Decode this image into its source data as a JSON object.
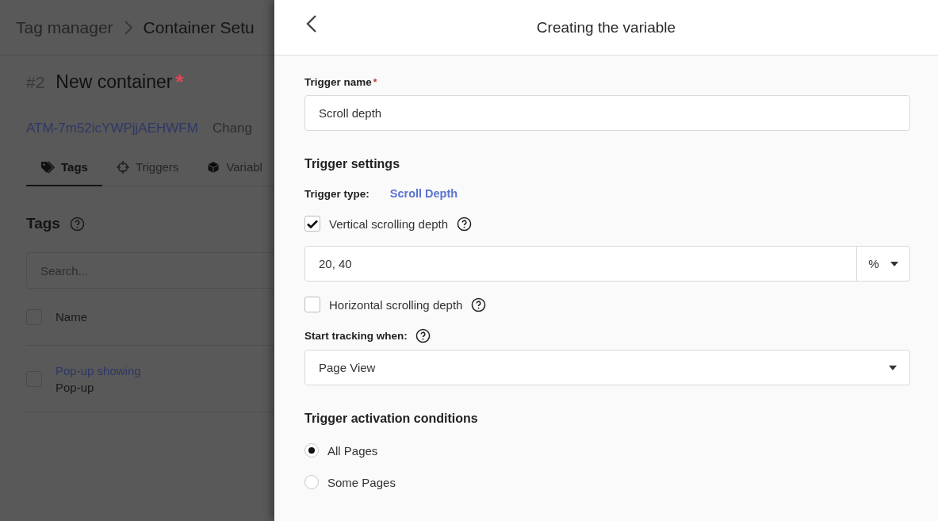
{
  "background": {
    "breadcrumb": [
      "Tag manager",
      "Container Setu"
    ],
    "container": {
      "number": "#2",
      "name": "New container",
      "required_mark": "*"
    },
    "container_id": "ATM-7m52icYWPjjAEHWFM",
    "change_link": "Chang",
    "tabs": [
      {
        "label": "Tags",
        "selected": true
      },
      {
        "label": "Triggers",
        "selected": false
      },
      {
        "label": "Variabl",
        "selected": false
      }
    ],
    "section_title": "Tags",
    "search": {
      "placeholder": "Search..."
    },
    "table": {
      "select_all_checked": false,
      "columns": [
        "Name"
      ],
      "rows": [
        {
          "name": "Pop-up showing",
          "type": "Pop-up",
          "checked": false
        }
      ]
    }
  },
  "panel": {
    "title": "Creating the variable",
    "trigger_name": {
      "label": "Trigger name",
      "required_mark": "*",
      "value": "Scroll depth"
    },
    "settings_title": "Trigger settings",
    "trigger_type": {
      "label": "Trigger type:",
      "value": "Scroll Depth"
    },
    "vertical": {
      "label": "Vertical scrolling depth",
      "checked": true,
      "value": "20, 40",
      "unit": "%"
    },
    "horizontal": {
      "label": "Horizontal scrolling depth",
      "checked": false
    },
    "start_tracking": {
      "label": "Start tracking when:",
      "value": "Page View"
    },
    "conditions_title": "Trigger activation conditions",
    "conditions": [
      {
        "label": "All Pages",
        "selected": true
      },
      {
        "label": "Some Pages",
        "selected": false
      }
    ]
  }
}
